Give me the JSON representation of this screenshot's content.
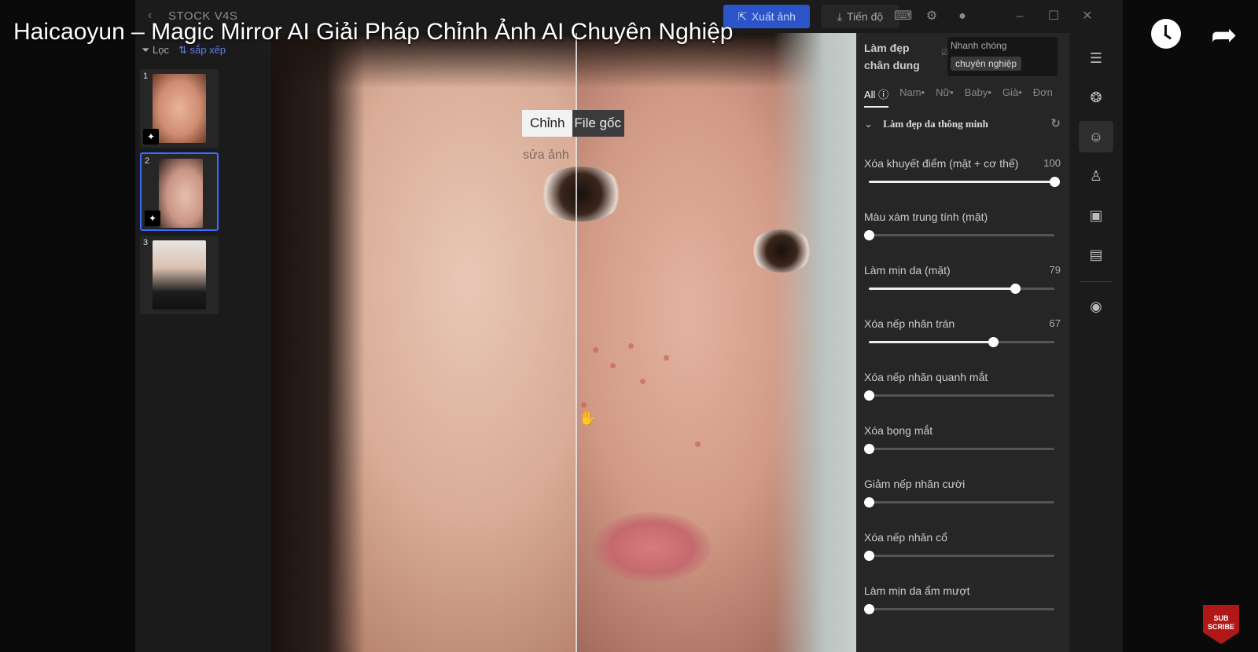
{
  "video": {
    "title": "Haicaoyun – Magic Mirror AI Giải Pháp Chỉnh Ảnh AI Chuyên Nghiệp",
    "watch_later_icon": "clock-icon",
    "share_icon": "share-icon",
    "subscribe": "SUB SCRIBE"
  },
  "app": {
    "name": "STOCK V4S",
    "export_label": "Xuất ảnh",
    "progress_label": "Tiến độ",
    "accent": "#2b54c9"
  },
  "filmstrip": {
    "filter_label": "Lọc",
    "sort_label": "sắp xếp",
    "items": [
      {
        "num": "1",
        "selected": false
      },
      {
        "num": "2",
        "selected": true
      },
      {
        "num": "3",
        "selected": false
      }
    ]
  },
  "canvas": {
    "compare_edited": "Chỉnh",
    "compare_edited_sub": "sửa ảnh",
    "compare_original": "File gốc"
  },
  "panel": {
    "heading_line1": "Làm đẹp",
    "heading_line2": "chân dung",
    "mode_fast": "Nhanh chóng",
    "mode_pro": "chuyên nghiệp",
    "tabs": [
      "All",
      "Nam•",
      "Nữ•",
      "Baby•",
      "Già•",
      "Đơn"
    ],
    "section_title": "Làm đẹp da thông minh",
    "sliders": [
      {
        "label": "Xóa khuyết điểm (mặt + cơ thể)",
        "value": "100",
        "level": 100
      },
      {
        "label": "Màu xám trung tính (mặt)",
        "value": "",
        "level": 0
      },
      {
        "label": "Làm mịn da (mặt)",
        "value": "79",
        "level": 79
      },
      {
        "label": "Xóa nếp nhăn trán",
        "value": "67",
        "level": 67
      },
      {
        "label": "Xóa nếp nhăn quanh mắt",
        "value": "",
        "level": 0
      },
      {
        "label": "Xóa bọng mắt",
        "value": "",
        "level": 0
      },
      {
        "label": "Giảm nếp nhăn cười",
        "value": "",
        "level": 0
      },
      {
        "label": "Xóa nếp nhăn cổ",
        "value": "",
        "level": 0
      },
      {
        "label": "Làm mịn da ẩm mượt",
        "value": "",
        "level": 0
      }
    ]
  }
}
